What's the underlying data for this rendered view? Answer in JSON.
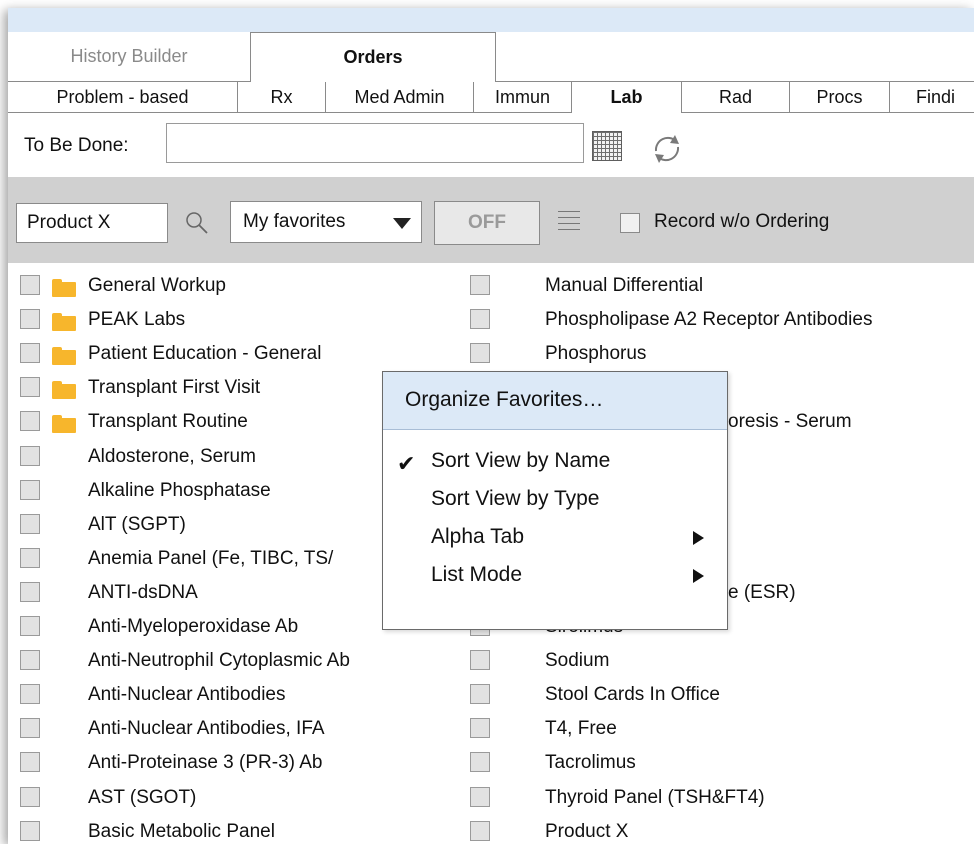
{
  "top_tabs": {
    "history": "History Builder",
    "orders": "Orders"
  },
  "sub_tabs": [
    "Problem - based",
    "Rx",
    "Med Admin",
    "Immun",
    "Lab",
    "Rad",
    "Procs",
    "Findi"
  ],
  "to_be_done": {
    "label": "To Be Done:",
    "value": ""
  },
  "toolbar": {
    "search_value": "Product X",
    "favorites_selected": "My favorites",
    "off_label": "OFF",
    "record_label": "Record w/o Ordering"
  },
  "left_list": [
    {
      "label": "General Workup",
      "folder": true
    },
    {
      "label": "PEAK Labs",
      "folder": true
    },
    {
      "label": "Patient Education - General",
      "folder": true
    },
    {
      "label": "Transplant First Visit",
      "folder": true
    },
    {
      "label": "Transplant Routine",
      "folder": true
    },
    {
      "label": "Aldosterone, Serum",
      "folder": false
    },
    {
      "label": "Alkaline Phosphatase",
      "folder": false
    },
    {
      "label": "AlT (SGPT)",
      "folder": false
    },
    {
      "label": "Anemia Panel (Fe, TIBC, TS/",
      "folder": false
    },
    {
      "label": "ANTI-dsDNA",
      "folder": false
    },
    {
      "label": "Anti-Myeloperoxidase Ab",
      "folder": false
    },
    {
      "label": "Anti-Neutrophil Cytoplasmic Ab",
      "folder": false
    },
    {
      "label": "Anti-Nuclear Antibodies",
      "folder": false
    },
    {
      "label": "Anti-Nuclear Antibodies, IFA",
      "folder": false
    },
    {
      "label": "Anti-Proteinase 3 (PR-3) Ab",
      "folder": false
    },
    {
      "label": "AST (SGOT)",
      "folder": false
    },
    {
      "label": "Basic Metabolic Panel",
      "folder": false
    }
  ],
  "right_list": [
    "Manual Differential",
    "Phospholipase A2 Receptor Antibodies",
    "Phosphorus",
    "",
    "oresis - Serum",
    "",
    "",
    "",
    "",
    "e (ESR)",
    "Sirolimus",
    "Sodium",
    "Stool Cards In Office",
    "T4, Free",
    "Tacrolimus",
    "Thyroid Panel (TSH&FT4)",
    "Product X"
  ],
  "popup": {
    "header": "Organize Favorites…",
    "items": [
      {
        "label": "Sort View by Name",
        "checked": true,
        "submenu": false
      },
      {
        "label": "Sort View by Type",
        "checked": false,
        "submenu": false
      },
      {
        "label": "Alpha Tab",
        "checked": false,
        "submenu": true
      },
      {
        "label": "List Mode",
        "checked": false,
        "submenu": true
      }
    ]
  },
  "colors": {
    "accent_blue": "#dce9f7",
    "toolbar_gray": "#d0d0d0",
    "folder": "#f7b62c"
  }
}
